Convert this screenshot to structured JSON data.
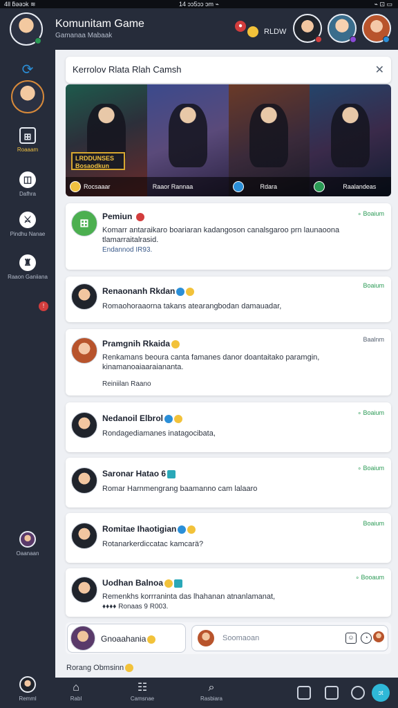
{
  "status_bar": {
    "left": "4ll ƃəəɔk ≋",
    "center": "14 ɔɔ5ɔɔ ɔm ⌁",
    "right": "⌁ ⊡ ▭"
  },
  "header": {
    "title": "Komunitam Game",
    "subtitle": "Gamanaa Mabaak",
    "badge_label": "RLDW"
  },
  "search": {
    "text": "Kerrolov Rlata Rlah Camsh"
  },
  "sidebar": {
    "items": [
      {
        "label": "Roaaam"
      },
      {
        "label": "Dafhra"
      },
      {
        "label": "Pindhu Nanae"
      },
      {
        "label": "Raaon Ganiiana"
      },
      {
        "label": "Oaanaan"
      },
      {
        "label": "Remml"
      }
    ]
  },
  "banner": {
    "logo_text": "LRDDUNSES Bosaodkun",
    "captions": [
      "Rocsaaar",
      "Raaor  Rannaa",
      "Rdara",
      "Raalandeas"
    ]
  },
  "posts": [
    {
      "name": "Pemiun",
      "time": "∘ Boaium",
      "body": "Komarr antaraikaro boariaran kadangoson canalsgaroo prn launaoona tlamarraitalrasid.",
      "meta": "Endannod IR93."
    },
    {
      "name": "Renaonanh Rkdan",
      "time": "Boaium",
      "body": "Romaohoraaorna takans atearangbodan damauadar,",
      "meta": ""
    },
    {
      "name": "Pramgnih Rkaida",
      "time": "Baalnm",
      "body": "Renkamans beoura canta famanes danor doantaitako paramgin, kinamanoaiaaraiananta.",
      "meta": "Reiniilan   Raano"
    },
    {
      "name": "Nedanoil Elbrol",
      "time": "∘ Boaium",
      "body": "Rondagediamanes inatagocibata,",
      "meta": ""
    },
    {
      "name": "Saronar Hatao  6",
      "time": "∘ Boaium",
      "body": "Romar Harnmengrang baamanno cam lalaaro",
      "meta": ""
    },
    {
      "name": "Romitae Ihaotigian",
      "time": "Boaium",
      "body": "Rotanarkerdiccatac kamcarä?",
      "meta": ""
    },
    {
      "name": "Uodhan Balnoa",
      "time": "∘ Booaum",
      "body": "Remenkhs korrraninta das lhahanan atnanlamanat,",
      "meta": "♦♦♦♦  Ronaas  9 R003."
    }
  ],
  "composer": {
    "name": "Gnoaahania",
    "placeholder": "Soomaoan"
  },
  "footer": {
    "text": "Rorang Obmsinn"
  },
  "bottom_nav": {
    "items": [
      {
        "label": "Rabl"
      },
      {
        "label": "Camsnae"
      },
      {
        "label": "Rasbiara"
      }
    ],
    "fab_label": "ɔt"
  },
  "colors": {
    "accent_online": "#2a9a55",
    "brand_dark": "#262c3a",
    "fab": "#2fb8d8",
    "active_label": "#f0c040"
  },
  "icons": [
    "refresh-icon",
    "bookmark-icon",
    "calendar-icon",
    "close-icon",
    "home-icon",
    "chat-icon",
    "search-icon",
    "notification-icon",
    "gallery-icon",
    "gear-icon"
  ]
}
